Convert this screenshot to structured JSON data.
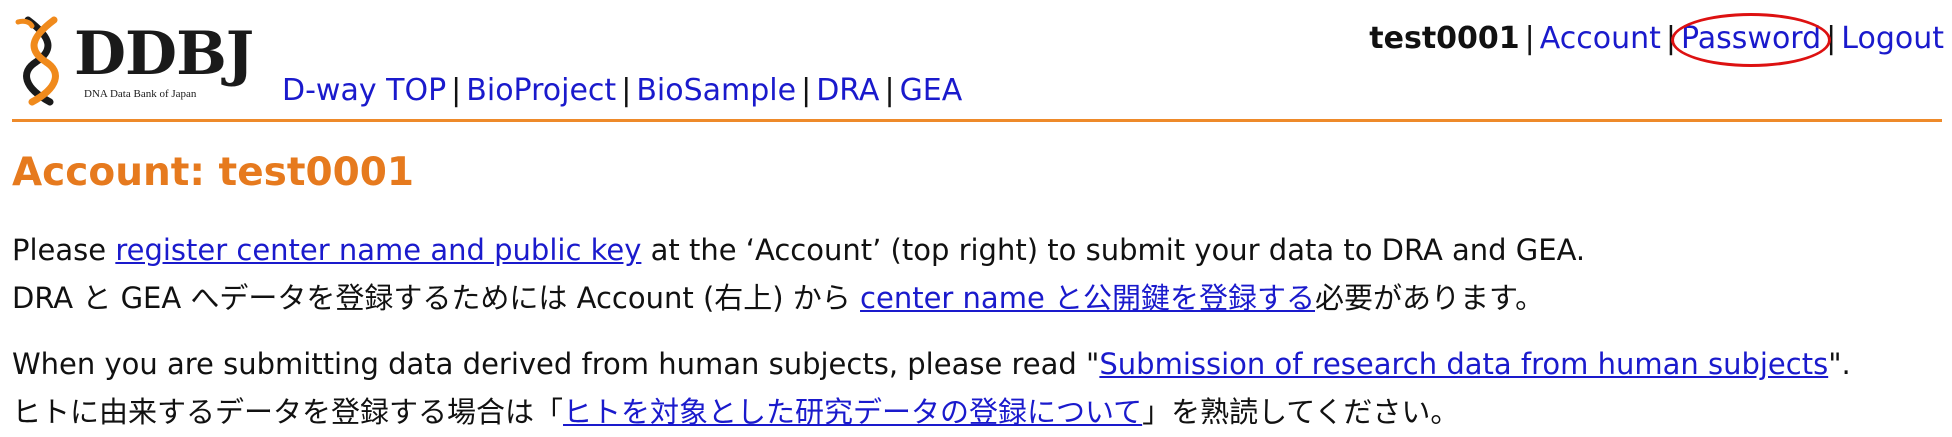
{
  "header": {
    "logo": {
      "name": "DDBJ",
      "subtitle": "DNA Data Bank of Japan"
    },
    "main_nav": [
      {
        "label": "D-way TOP"
      },
      {
        "label": "BioProject"
      },
      {
        "label": "BioSample"
      },
      {
        "label": "DRA"
      },
      {
        "label": "GEA"
      }
    ],
    "separator": "|",
    "user_nav": {
      "username": "test0001",
      "account": "Account",
      "password": "Password",
      "logout": "Logout"
    }
  },
  "main": {
    "title": "Account: test0001",
    "intro": {
      "en_prefix": "Please ",
      "en_link": "register center name and public key",
      "en_suffix": " at the ‘Account’ (top right) to submit your data to DRA and GEA.",
      "ja_prefix": "DRA と GEA へデータを登録するためには Account (右上) から ",
      "ja_link": "center name と公開鍵を登録する",
      "ja_suffix": "必要があります。"
    },
    "human": {
      "en_prefix": "When you are submitting data derived from human subjects, please read \"",
      "en_link": "Submission of research data from human subjects",
      "en_suffix": "\".",
      "ja_prefix": "ヒトに由来するデータを登録する場合は「",
      "ja_link": "ヒトを対象とした研究データの登録について",
      "ja_suffix": "」を熟読してください。"
    }
  },
  "colors": {
    "accent_orange": "#e67a1e",
    "divider": "#ee8a2a",
    "link": "#1a1acc",
    "highlight_ring": "#dd1111"
  },
  "icons": {
    "logo_mark": "dna-helix-icon"
  }
}
